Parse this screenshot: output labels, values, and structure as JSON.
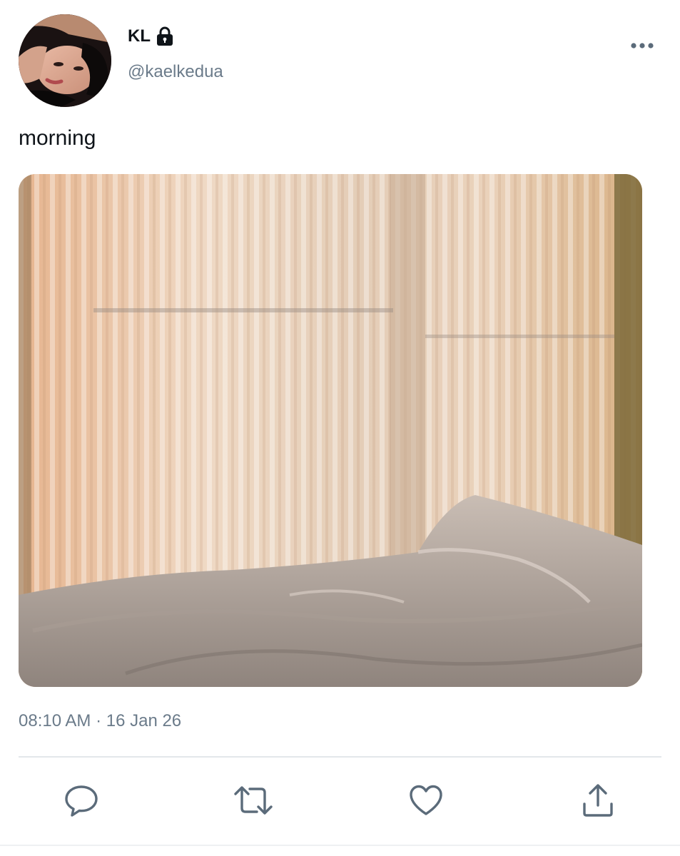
{
  "author": {
    "display_name": "KL",
    "handle": "@kaelkedua",
    "protected": true
  },
  "tweet": {
    "text": "morning",
    "timestamp": "08:10 AM · 16 Jan 26"
  },
  "icons": {
    "more": "more-horizontal-icon",
    "reply": "reply-icon",
    "retweet": "retweet-icon",
    "like": "heart-icon",
    "share": "share-icon",
    "lock": "lock-icon"
  },
  "colors": {
    "text_primary": "#0f1419",
    "text_secondary": "#6b7b8a",
    "icon": "#5b6b7a",
    "divider": "#e3e7ea"
  }
}
